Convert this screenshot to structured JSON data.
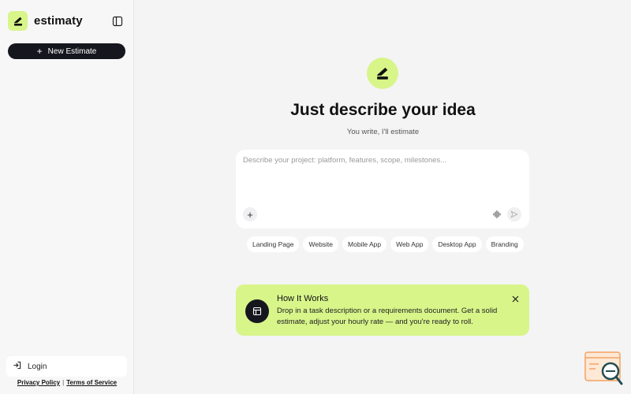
{
  "brand": {
    "name": "estimaty"
  },
  "sidebar": {
    "new_estimate_label": "New Estimate",
    "login_label": "Login",
    "privacy_label": "Privacy Policy",
    "separator": "|",
    "terms_label": "Terms of Service"
  },
  "main": {
    "title": "Just describe your idea",
    "subtitle": "You write, I'll estimate",
    "composer": {
      "placeholder": "Describe your project: platform, features, scope, milestones...",
      "value": ""
    },
    "chips": [
      "Landing Page",
      "Website",
      "Mobile App",
      "Web App",
      "Desktop App",
      "Branding"
    ]
  },
  "how_it_works": {
    "title": "How It Works",
    "text": "Drop in a task description or a requirements document. Get a solid estimate, adjust your hourly rate — and you're ready to roll."
  },
  "colors": {
    "accent": "#d8f58a",
    "dark": "#16161e",
    "background": "#f4f4f5",
    "sidebar": "#f7f7f8"
  },
  "icons": {
    "logo": "estimaty-logo-icon",
    "panel_toggle": "sidebar-toggle-icon",
    "plus": "plus-icon",
    "login": "login-icon",
    "voice": "audio-waveform-icon",
    "send": "send-icon",
    "how": "layout-icon",
    "close": "close-icon",
    "widget": "help-widget-icon"
  }
}
